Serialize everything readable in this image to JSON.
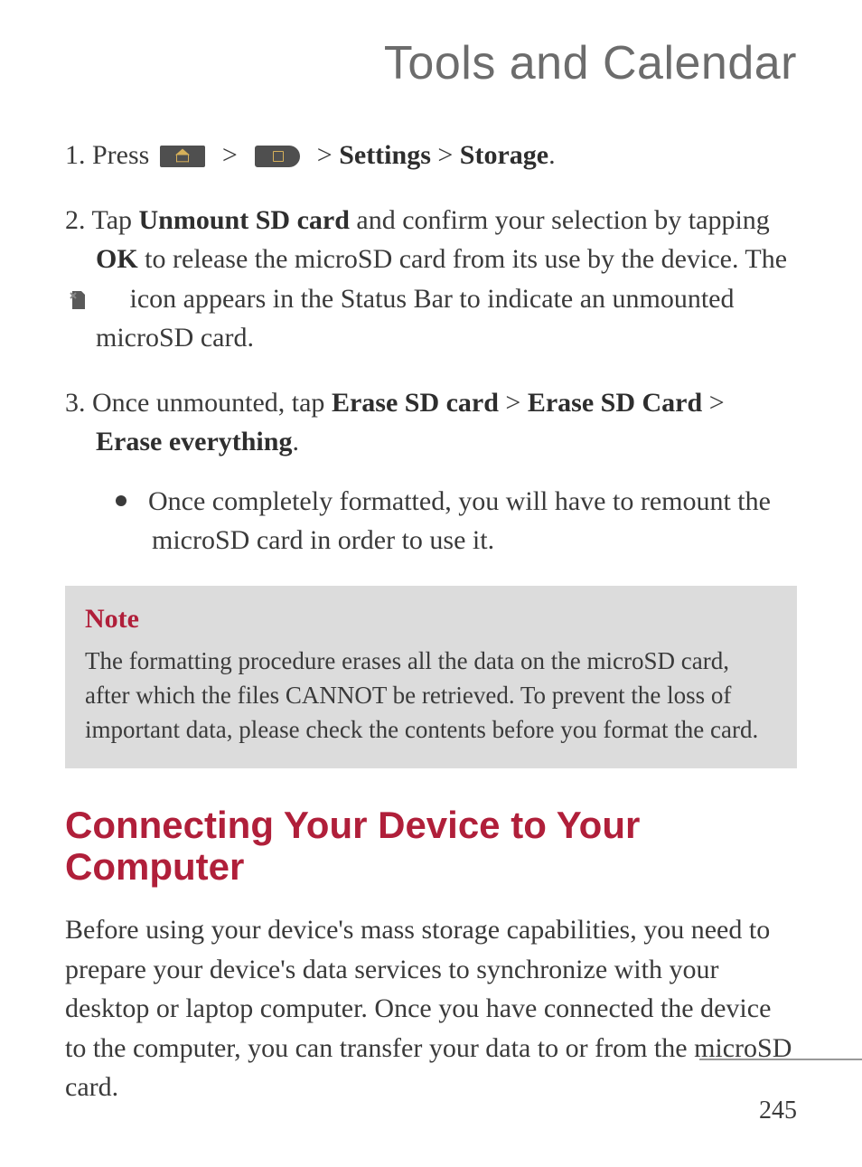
{
  "chapter_title": "Tools and Calendar",
  "steps": {
    "s1": {
      "num": "1.",
      "lead": "Press",
      "sep": ">",
      "settings": "Settings",
      "storage": "Storage",
      "period": "."
    },
    "s2": {
      "num": "2.",
      "lead": "Tap",
      "unmount": "Unmount SD card",
      "mid1": "and confirm your selection by tapping",
      "ok": "OK",
      "mid2": "to release the microSD card from its use by the device. The",
      "mid3": "icon appears in the Status Bar to indicate an unmounted microSD card."
    },
    "s3": {
      "num": "3.",
      "lead": "Once unmounted, tap",
      "erase1": "Erase SD card",
      "sep": ">",
      "erase2": "Erase SD Card",
      "erase3": "Erase everything",
      "period": "."
    },
    "bullet": "Once completely formatted, you will have to remount the microSD card in order to use it."
  },
  "note": {
    "title": "Note",
    "text": "The formatting procedure erases all the data on the microSD card, after which the files CANNOT be retrieved. To prevent the loss of important data, please check the contents before you format the card."
  },
  "section_heading": "Connecting Your Device to Your Computer",
  "section_para": "Before using your device's mass storage capabilities, you need to prepare your device's data services to synchronize with your desktop or laptop computer. Once you have connected the device to the computer, you can transfer your data to or from the microSD card.",
  "page_number": "245"
}
